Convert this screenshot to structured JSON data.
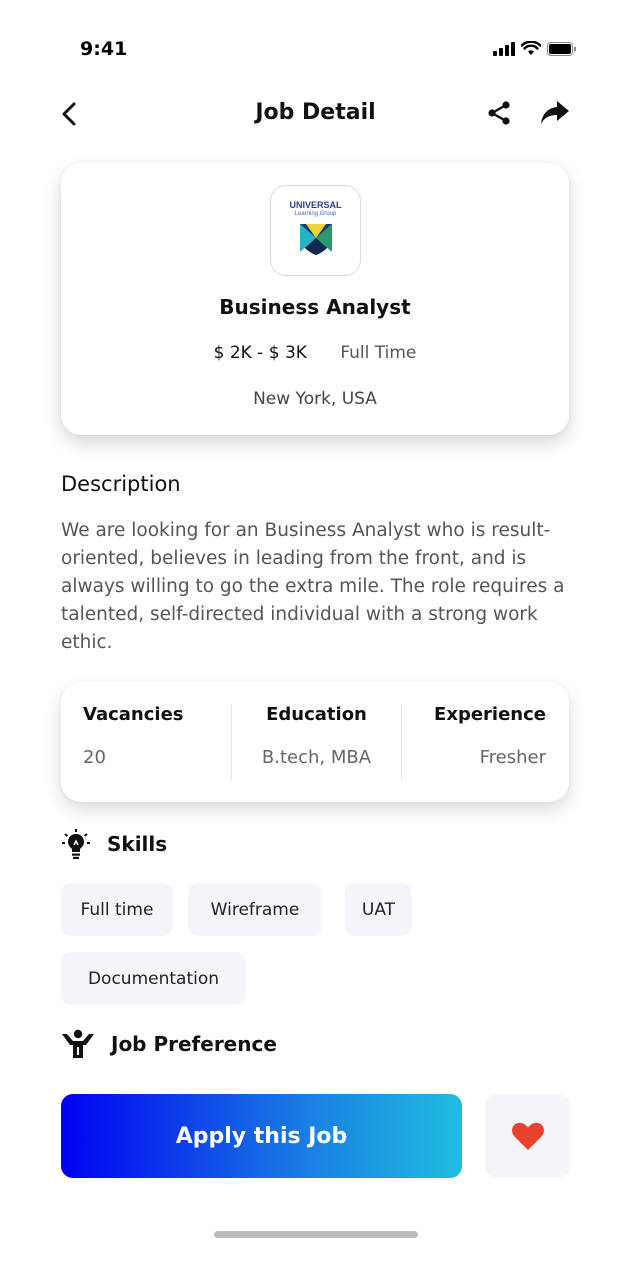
{
  "status_bar": {
    "time": "9:41"
  },
  "nav": {
    "title": "Job Detail"
  },
  "job": {
    "logo": {
      "line1": "UNIVERSAL",
      "line2": "Learning Group"
    },
    "title": "Business Analyst",
    "salary": "$ 2K - $ 3K",
    "type": "Full Time",
    "location": "New York, USA"
  },
  "description": {
    "title": "Description",
    "text": "We are looking for an Business Analyst who is result-oriented, believes in leading from the front, and is always willing to go the extra mile. The role requires a talented, self-directed individual with a strong work ethic."
  },
  "info": [
    {
      "label": "Vacancies",
      "value": "20"
    },
    {
      "label": "Education",
      "value": "B.tech, MBA"
    },
    {
      "label": "Experience",
      "value": "Fresher"
    }
  ],
  "skills": {
    "title": "Skills",
    "items": [
      "Full time",
      "Wireframe",
      "UAT",
      "Documentation"
    ]
  },
  "job_preference": {
    "title": "Job Preference"
  },
  "actions": {
    "apply_label": "Apply this Job"
  },
  "colors": {
    "apply_gradient_start": "#0000f2",
    "apply_gradient_end": "#1fbde0",
    "heart": "#e8412e",
    "chip_bg": "#f4f4fa"
  },
  "icons": {
    "back": "chevron-left-icon",
    "share": "share-icon",
    "forward": "forward-arrow-icon",
    "skills": "lightbulb-icon",
    "preference": "person-icon",
    "favorite": "heart-icon"
  }
}
